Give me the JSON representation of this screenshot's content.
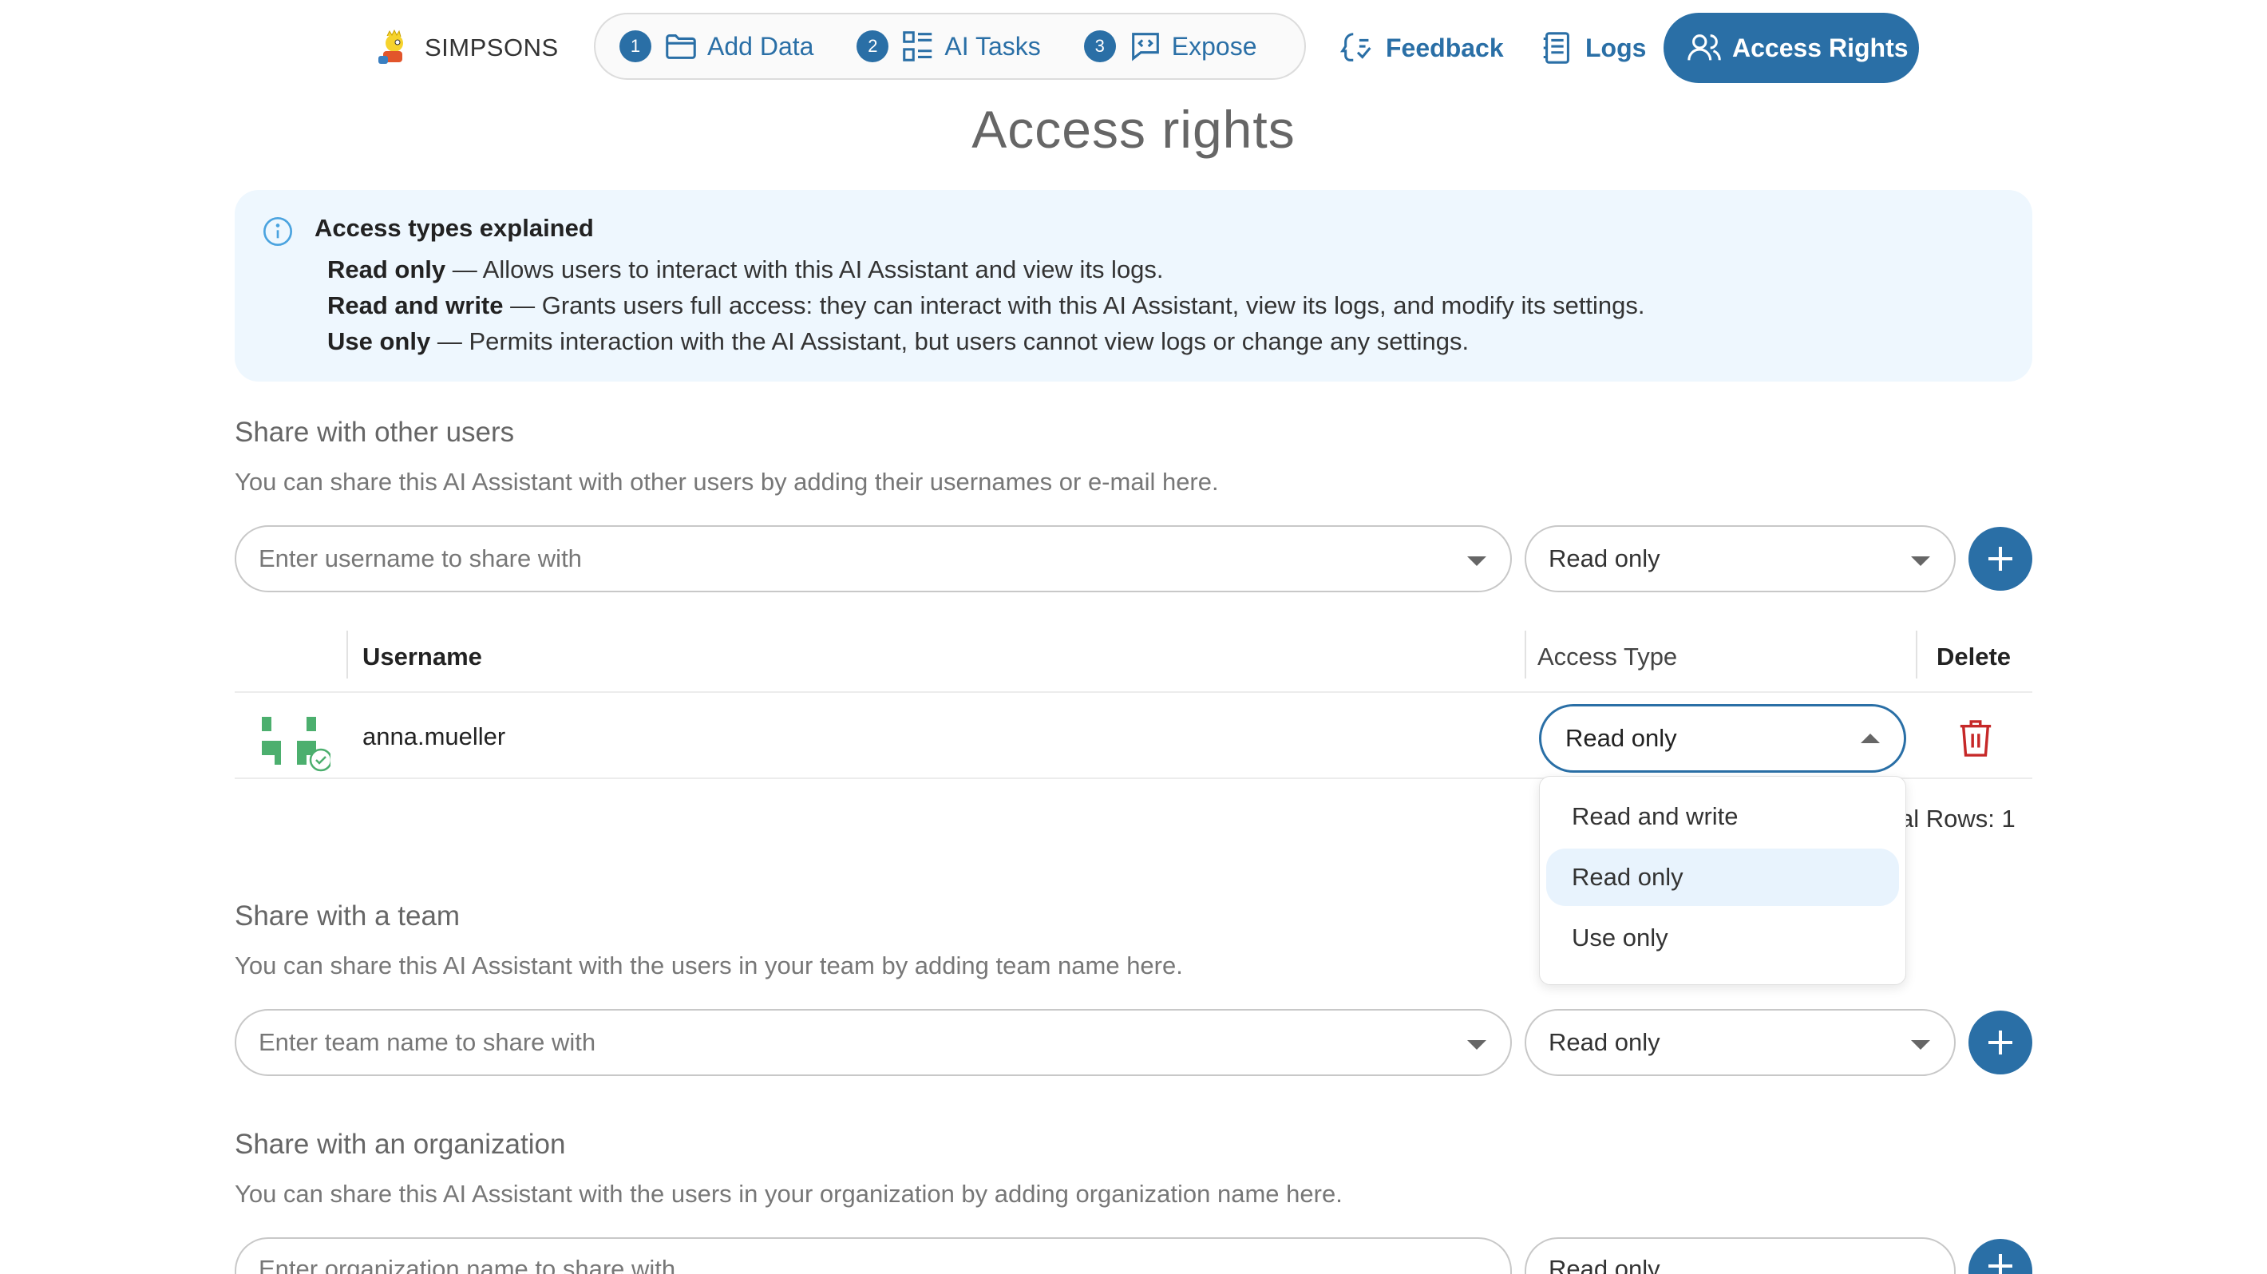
{
  "nav": {
    "brand": "SIMPSONS",
    "steps": [
      {
        "num": "1",
        "label": "Add Data",
        "icon": "folder-icon"
      },
      {
        "num": "2",
        "label": "AI Tasks",
        "icon": "list-icon"
      },
      {
        "num": "3",
        "label": "Expose",
        "icon": "code-bubble-icon"
      }
    ],
    "feedback": "Feedback",
    "logs": "Logs",
    "access_rights": "Access Rights"
  },
  "page_title": "Access rights",
  "info": {
    "title": "Access types explained",
    "items": [
      {
        "term": "Read only",
        "desc": " — Allows users to interact with this AI Assistant and view its logs."
      },
      {
        "term": "Read and write",
        "desc": " — Grants users full access: they can interact with this AI Assistant, view its logs, and modify its settings."
      },
      {
        "term": "Use only",
        "desc": " — Permits interaction with the AI Assistant, but users cannot view logs or change any settings."
      }
    ]
  },
  "users": {
    "title": "Share with other users",
    "desc": "You can share this AI Assistant with other users by adding their usernames or e-mail here.",
    "placeholder": "Enter username to share with",
    "access": "Read only"
  },
  "table": {
    "headers": {
      "username": "Username",
      "access_type": "Access Type",
      "delete": "Delete"
    },
    "rows": [
      {
        "username": "anna.mueller",
        "access": "Read only"
      }
    ],
    "total_text": "al Rows: 1"
  },
  "dropdown": {
    "options": [
      "Read and write",
      "Read only",
      "Use only"
    ],
    "selected": "Read only"
  },
  "team": {
    "title": "Share with a team",
    "desc": "You can share this AI Assistant with the users in your team by adding team name here.",
    "placeholder": "Enter team name to share with",
    "access": "Read only"
  },
  "org": {
    "title": "Share with an organization",
    "desc": "You can share this AI Assistant with the users in your organization by adding organization name here.",
    "placeholder": "Enter organization name to share with",
    "access": "Read only"
  },
  "colors": {
    "accent": "#2a6fa6",
    "info_bg": "#eef7fe",
    "danger": "#c62828",
    "avatar": "#4caf6e"
  }
}
